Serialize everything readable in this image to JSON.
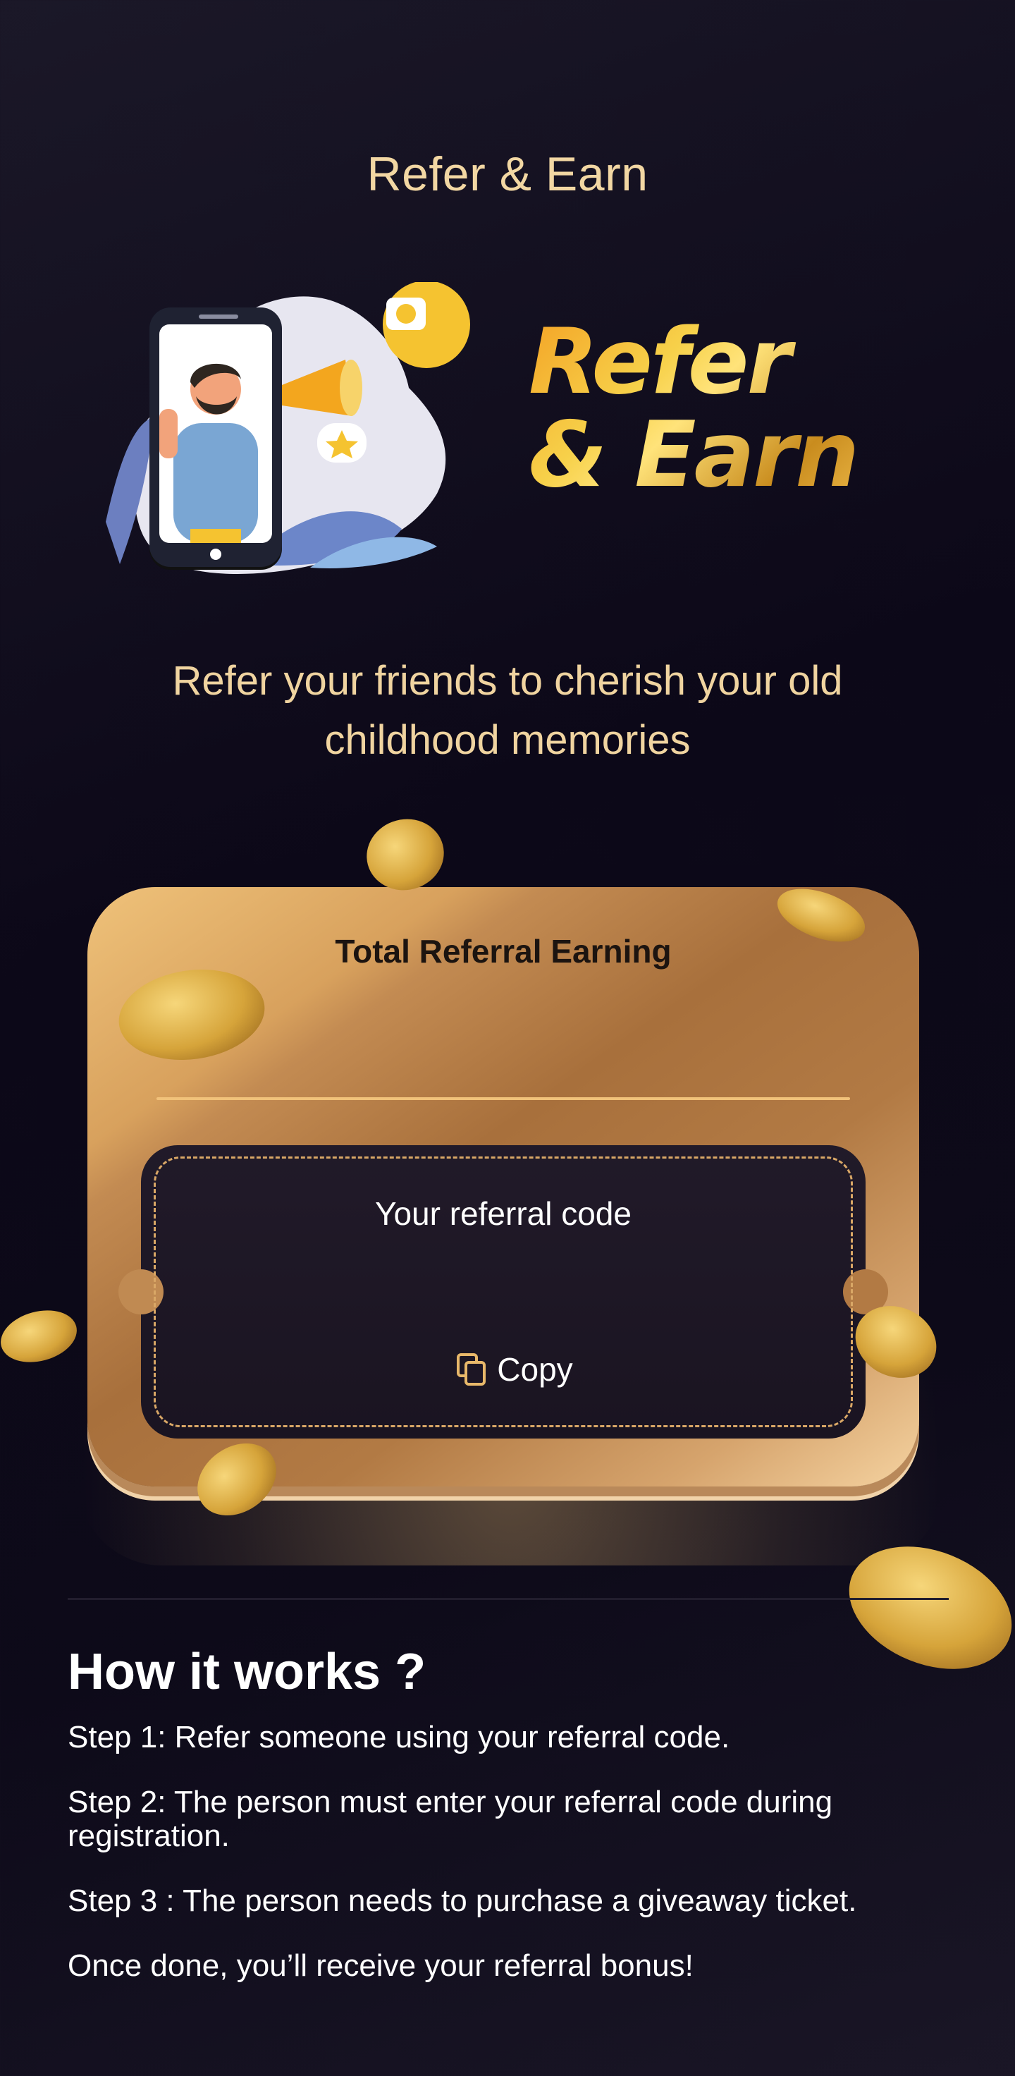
{
  "header": {
    "title": "Refer & Earn"
  },
  "hero": {
    "title_line1": "Refer",
    "title_line2": "& Earn"
  },
  "subtitle": "Refer your friends to cherish your old childhood memories",
  "card": {
    "title": "Total Referral Earning",
    "referral_label": "Your referral code",
    "copy_label": "Copy"
  },
  "how_it_works": {
    "title": "How it works ?",
    "steps": [
      "Step 1: Refer someone using your referral code.",
      "Step 2:  The person must enter your referral code during registration.",
      "Step 3 : The person needs to purchase a giveaway ticket.",
      "Once done, you’ll receive your referral bonus!"
    ]
  },
  "colors": {
    "accent_gold": "#f2d7a3",
    "background": "#0c0818",
    "card_gold": "#c38b52"
  },
  "icons": {
    "copy": "copy-icon",
    "megaphone": "megaphone-icon",
    "coin": "coin-icon"
  }
}
